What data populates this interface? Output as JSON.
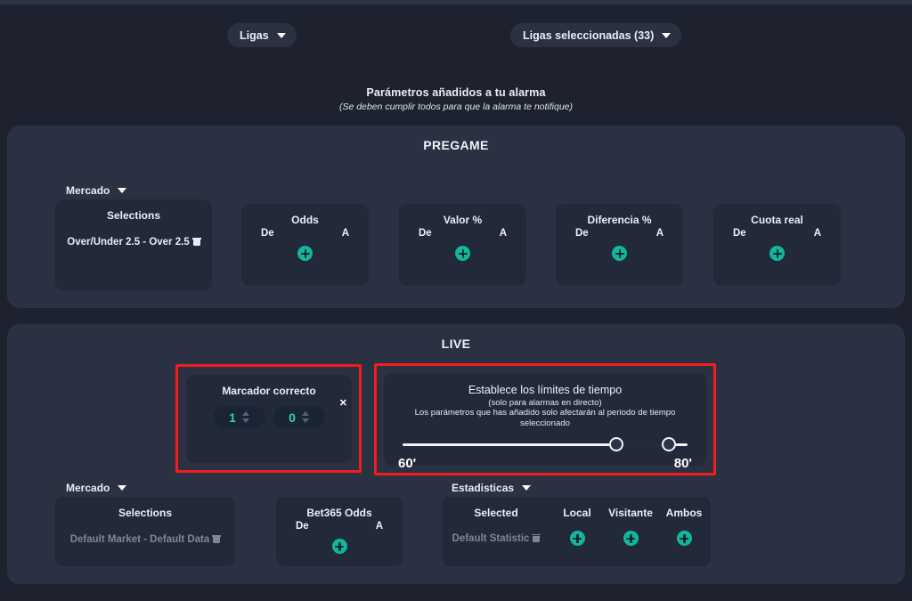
{
  "top_bar": {
    "leagues_button": "Ligas",
    "leagues_selected_button": "Ligas seleccionadas (33)"
  },
  "heading": {
    "title": "Parámetros añadidos a tu alarma",
    "subtitle": "(Se deben cumplir todos para que la alarma te notifique)"
  },
  "pregame": {
    "panel_title": "PREGAME",
    "market_dropdown": "Mercado",
    "selections_card": {
      "title": "Selections",
      "item": "Over/Under 2.5 - Over 2.5"
    },
    "range_cards": [
      {
        "title": "Odds",
        "from_label": "De",
        "to_label": "A"
      },
      {
        "title": "Valor %",
        "from_label": "De",
        "to_label": "A"
      },
      {
        "title": "Diferencia %",
        "from_label": "De",
        "to_label": "A"
      },
      {
        "title": "Cuota real",
        "from_label": "De",
        "to_label": "A"
      }
    ]
  },
  "live": {
    "panel_title": "LIVE",
    "market_dropdown": "Mercado",
    "statistics_dropdown": "Estadisticas",
    "correct_score": {
      "title": "Marcador correcto",
      "home_value": "1",
      "away_value": "0",
      "close_label": "✕"
    },
    "time_limits": {
      "title": "Establece los límites de tiempo",
      "subtitle": "(solo para alarmas en directo)",
      "note": "Los parámetros que has añadido solo afectarán al periodo de tiempo seleccionado",
      "min_label": "60'",
      "max_label": "80'"
    },
    "selections_card": {
      "title": "Selections",
      "item": "Default Market - Default Data"
    },
    "bet365_card": {
      "title": "Bet365 Odds",
      "from_label": "De",
      "to_label": "A"
    },
    "statistics_card": {
      "columns": [
        "Selected",
        "Local",
        "Visitante",
        "Ambos"
      ],
      "row_label": "Default Statistic"
    }
  },
  "colors": {
    "page_background": "#1d222e",
    "panel_background": "#2a3142",
    "card_background": "#222939",
    "accent_teal": "#0fb89b",
    "value_teal": "#23d6a8",
    "highlight_red": "#f41c1c"
  }
}
